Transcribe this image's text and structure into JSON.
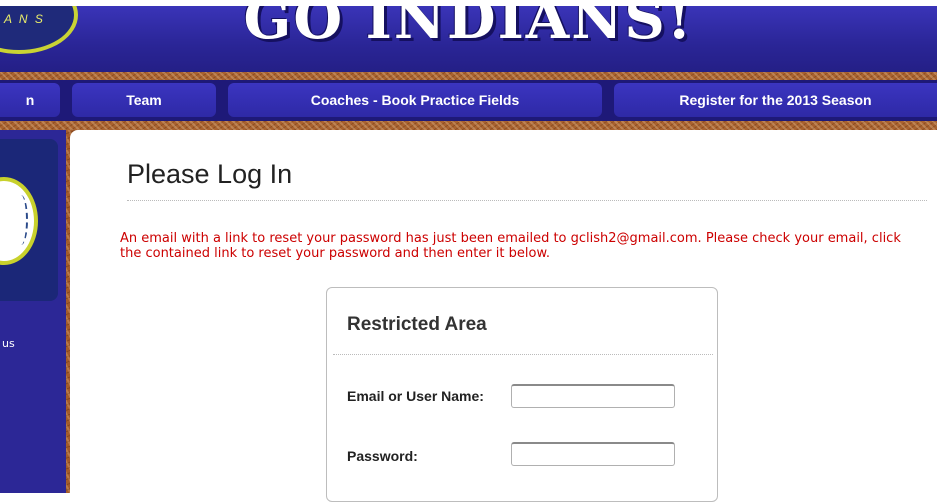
{
  "header": {
    "logo_text": "A N S",
    "banner_title": "GO INDIANS!"
  },
  "nav": {
    "items": [
      {
        "label": "n"
      },
      {
        "label": "Team"
      },
      {
        "label": "Coaches - Book Practice Fields"
      },
      {
        "label": "Register for the 2013 Season"
      }
    ]
  },
  "sidebar": {
    "text": "us"
  },
  "main": {
    "title": "Please Log In",
    "notice": "An email with a link to reset your password has just been emailed to gclish2@gmail.com. Please check your email, click the contained link to reset your password and then enter it below."
  },
  "login": {
    "heading": "Restricted Area",
    "email_label": "Email or User Name:",
    "email_value": "",
    "password_label": "Password:",
    "password_value": ""
  },
  "colors": {
    "header_blue": "#2a2596",
    "nav_button": "#3b35c0",
    "notice_red": "#cc0000",
    "dirt": "#a45c2b"
  }
}
